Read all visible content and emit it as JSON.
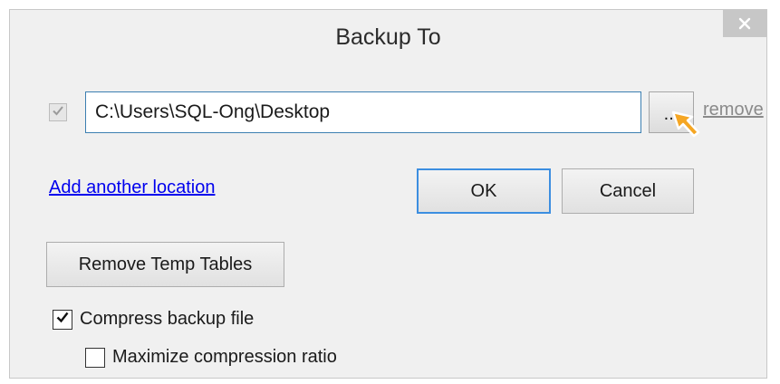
{
  "window": {
    "title": "Backup To",
    "close_icon": "close-icon"
  },
  "location": {
    "checked": true,
    "path_value": "C:\\Users\\SQL-Ong\\Desktop",
    "browse_label": "...",
    "remove_label": "remove"
  },
  "actions": {
    "add_location_label": "Add another location",
    "ok_label": "OK",
    "cancel_label": "Cancel",
    "remove_temp_label": "Remove Temp Tables"
  },
  "options": {
    "compress_label": "Compress backup file",
    "compress_checked": true,
    "maximize_label": "Maximize compression ratio",
    "maximize_checked": false
  },
  "colors": {
    "dialog_bg": "#f0f0f0",
    "input_border": "#3c7fb1",
    "link_blue": "#0000ee",
    "ok_focus_border": "#3c8ee0",
    "cursor_orange": "#f5a623"
  }
}
